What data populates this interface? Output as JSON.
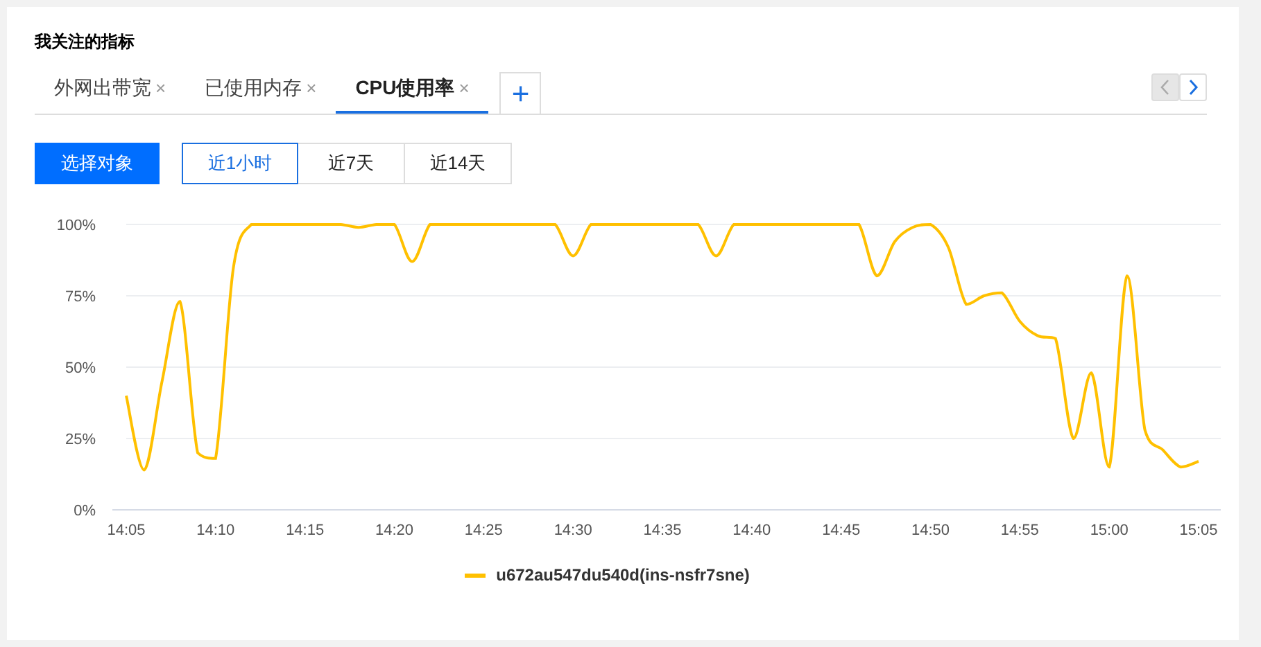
{
  "panel": {
    "title": "我关注的指标"
  },
  "tabs": [
    {
      "label": "外网出带宽",
      "close": "×",
      "selected": false
    },
    {
      "label": "已使用内存",
      "close": "×",
      "selected": false
    },
    {
      "label": "CPU使用率",
      "close": "×",
      "selected": true
    }
  ],
  "add_tab": "+",
  "select_button": "选择对象",
  "ranges": [
    {
      "label": "近1小时",
      "selected": true
    },
    {
      "label": "近7天",
      "selected": false
    },
    {
      "label": "近14天",
      "selected": false
    }
  ],
  "chart": {
    "chart_data": {
      "type": "line",
      "categories": [
        "14:05",
        null,
        null,
        null,
        null,
        "14:10",
        null,
        null,
        null,
        null,
        "14:15",
        null,
        null,
        null,
        null,
        "14:20",
        null,
        null,
        null,
        null,
        "14:25",
        null,
        null,
        null,
        null,
        "14:30",
        null,
        null,
        null,
        null,
        "14:35",
        null,
        null,
        null,
        null,
        "14:40",
        null,
        null,
        null,
        null,
        "14:45",
        null,
        null,
        null,
        null,
        "14:50",
        null,
        null,
        null,
        null,
        "14:55",
        null,
        null,
        null,
        null,
        "15:00",
        null,
        null,
        null,
        null,
        "15:05"
      ],
      "yticks": [
        {
          "value": 0,
          "label": "0%"
        },
        {
          "value": 25,
          "label": "25%"
        },
        {
          "value": 50,
          "label": "50%"
        },
        {
          "value": 75,
          "label": "75%"
        },
        {
          "value": 100,
          "label": "100%"
        }
      ],
      "ylim": [
        0,
        100
      ],
      "grid": true,
      "series": [
        {
          "name": "u672au547du540d(ins-nsfr7sne)",
          "color": "#ffc000",
          "values": [
            40,
            14,
            45,
            73,
            20,
            18,
            85,
            100,
            100,
            100,
            100,
            100,
            100,
            99,
            100,
            100,
            87,
            100,
            100,
            100,
            100,
            100,
            100,
            100,
            100,
            89,
            100,
            100,
            100,
            100,
            100,
            100,
            100,
            89,
            100,
            100,
            100,
            100,
            100,
            100,
            100,
            100,
            82,
            94,
            99,
            100,
            92,
            72,
            75,
            76,
            66,
            61,
            60,
            25,
            48,
            15,
            82,
            28,
            21,
            15,
            17
          ]
        }
      ]
    }
  }
}
